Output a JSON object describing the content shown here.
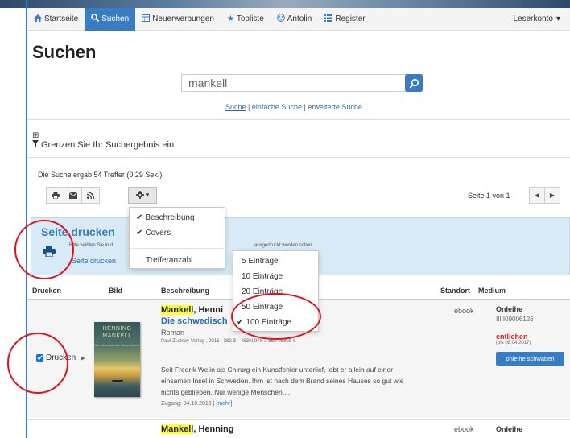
{
  "nav": {
    "items": [
      {
        "label": "Startseite",
        "icon": "home-icon"
      },
      {
        "label": "Suchen",
        "icon": "search-icon",
        "active": true
      },
      {
        "label": "Neuerwerbungen",
        "icon": "calendar-icon"
      },
      {
        "label": "Topliste",
        "icon": "star-icon"
      },
      {
        "label": "Antolin",
        "icon": "antolin-icon"
      },
      {
        "label": "Register",
        "icon": "list-icon"
      }
    ],
    "account": "Leserkonto"
  },
  "page_title": "Suchen",
  "search": {
    "value": "mankell",
    "links": {
      "suche": "Suche",
      "sep1": "|",
      "einfache": "einfache Suche",
      "sep2": "|",
      "erweiterte": "erweiterte Suche"
    }
  },
  "filter": {
    "toggle": "⊞",
    "label": "Grenzen Sie Ihr Suchergebnis ein"
  },
  "results": {
    "count_text": "Die Suche ergab 54 Treffer (0,29 Sek.).",
    "page_info": "Seite 1 von 1"
  },
  "print_panel": {
    "title": "Seite drucken",
    "hint_start": "Bitte wählen Sie in d",
    "hint_end": "ausgedruckt werden sollen.",
    "link": "Seite drucken"
  },
  "settings_menu": {
    "items": [
      {
        "label": "Beschreibung",
        "checked": true
      },
      {
        "label": "Covers",
        "checked": true
      }
    ],
    "submenu_label": "Trefferanzahl"
  },
  "hits_menu": {
    "options": [
      {
        "label": "5 Einträge",
        "checked": false
      },
      {
        "label": "10 Einträge",
        "checked": false
      },
      {
        "label": "20 Einträge",
        "checked": false
      },
      {
        "label": "50 Einträge",
        "checked": false
      },
      {
        "label": "100 Einträge",
        "checked": true
      }
    ]
  },
  "table": {
    "headers": {
      "print": "Drucken",
      "image": "Bild",
      "description": "Beschreibung",
      "location": "Standort",
      "medium": "Medium"
    }
  },
  "record1": {
    "print_label": "Drucken",
    "cover_author_line1": "HENNING",
    "cover_author_line2": "MANKELL",
    "cover_title": "Die schwedischen Gummistiefel",
    "author_highlight": "Mankell",
    "author_rest": ", Henni",
    "title": "Die schwedisch",
    "genre": "Roman",
    "publisher": "Paul-Zsolnay-Verlag , 2016 - 382 S. - ISBN 978-3-552-05808-8",
    "blurb": "Seit Fredrik Welin als Chirurg ein Kunstfehler unterlief, lebt er allein auf einer einsamen Insel in Schweden. Ihm ist nach dem Brand seines Hauses so gut wie nichts geblieben. Nur wenige Menschen,...",
    "access_text": "Zugang: 04.10.2016 |",
    "more": "[mehr]",
    "location": "ebook",
    "medium": "Onleihe",
    "medium_id": "IIIII09006126",
    "status": "entliehen",
    "status_until": "(bis 08.04.2017)",
    "button": "onleihe schwaben"
  },
  "record2": {
    "author_highlight": "Mankell",
    "author_rest": ", Henning",
    "location": "ebook",
    "medium": "Onleihe"
  },
  "colors": {
    "accent": "#3a7cc2",
    "highlight": "#ffff33",
    "status": "#cc2a2a",
    "annotation": "#e0141e"
  }
}
